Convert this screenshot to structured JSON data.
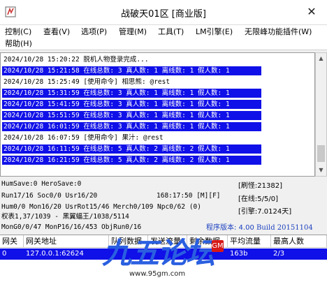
{
  "window": {
    "title": "战破天01区 [商业版]",
    "close_glyph": "✕"
  },
  "menu": [
    "控制(C)",
    "查看(V)",
    "选项(P)",
    "管理(M)",
    "工具(T)",
    "LM引擎(E)",
    "无限峰功能插件(W)",
    "帮助(H)"
  ],
  "log": [
    {
      "text": "2024/10/28 15:20:22 脱机人物登录完成...",
      "highlight": false
    },
    {
      "text": "2024/10/28 15:21:58 在线总数: 3 真人数: 1 离线数: 1 假人数: 1",
      "highlight": true
    },
    {
      "text": "2024/10/28 15:25:49 [使用命令] 相思熊: @rest",
      "highlight": false
    },
    {
      "text": "2024/10/28 15:31:59 在线总数: 3 真人数: 1 离线数: 1 假人数: 1",
      "highlight": true
    },
    {
      "text": "2024/10/28 15:41:59 在线总数: 3 真人数: 1 离线数: 1 假人数: 1",
      "highlight": true
    },
    {
      "text": "2024/10/28 15:51:59 在线总数: 3 真人数: 1 离线数: 1 假人数: 1",
      "highlight": true
    },
    {
      "text": "2024/10/28 16:01:59 在线总数: 3 真人数: 1 离线数: 1 假人数: 1",
      "highlight": true
    },
    {
      "text": "2024/10/28 16:07:59 [使用命令] 果汁: @rest",
      "highlight": false
    },
    {
      "text": "2024/10/28 16:11:59 在线总数: 5 真人数: 2 离线数: 2 假人数: 1",
      "highlight": true
    },
    {
      "text": "2024/10/28 16:21:59 在线总数: 5 真人数: 2 离线数: 2 假人数: 1",
      "highlight": true
    }
  ],
  "status": {
    "line1": "HumSave:0 HeroSave:0",
    "line2_left": "Run17/16 Soc0/0 Usr16/20",
    "line2_right": "168:17:50 [M][F]",
    "line3": "Hum0/0 Mon16/20 UsrRot15/46 Merch0/109 Npc0/62 (0)",
    "line4": "权表1,37/1039 - 黑翼蝠王/1038/5114",
    "line5": "MonG0/0/47 MonP16/16/453 ObjRun0/16",
    "crowd": "[刷怪:21382]",
    "online": "[在线:5/5/0]",
    "engine": "[引擎:7.0124天]",
    "version_label": "程序版本: 4.00",
    "version_build": "Build 20151104"
  },
  "table": {
    "headers": [
      "网关",
      "网关地址",
      "队列数据",
      "发送流量",
      "剩余数据",
      "平均流量",
      "最高人数"
    ],
    "rows": [
      [
        "0",
        "127.0.0.1:62624",
        "",
        "",
        "",
        "163b",
        "2/3"
      ]
    ]
  },
  "watermark": {
    "text": "九五论坛",
    "url": "www.95gm.com",
    "stamp": "GM"
  },
  "colors": {
    "highlight": "#1010e8",
    "version": "#1a3fbf"
  }
}
